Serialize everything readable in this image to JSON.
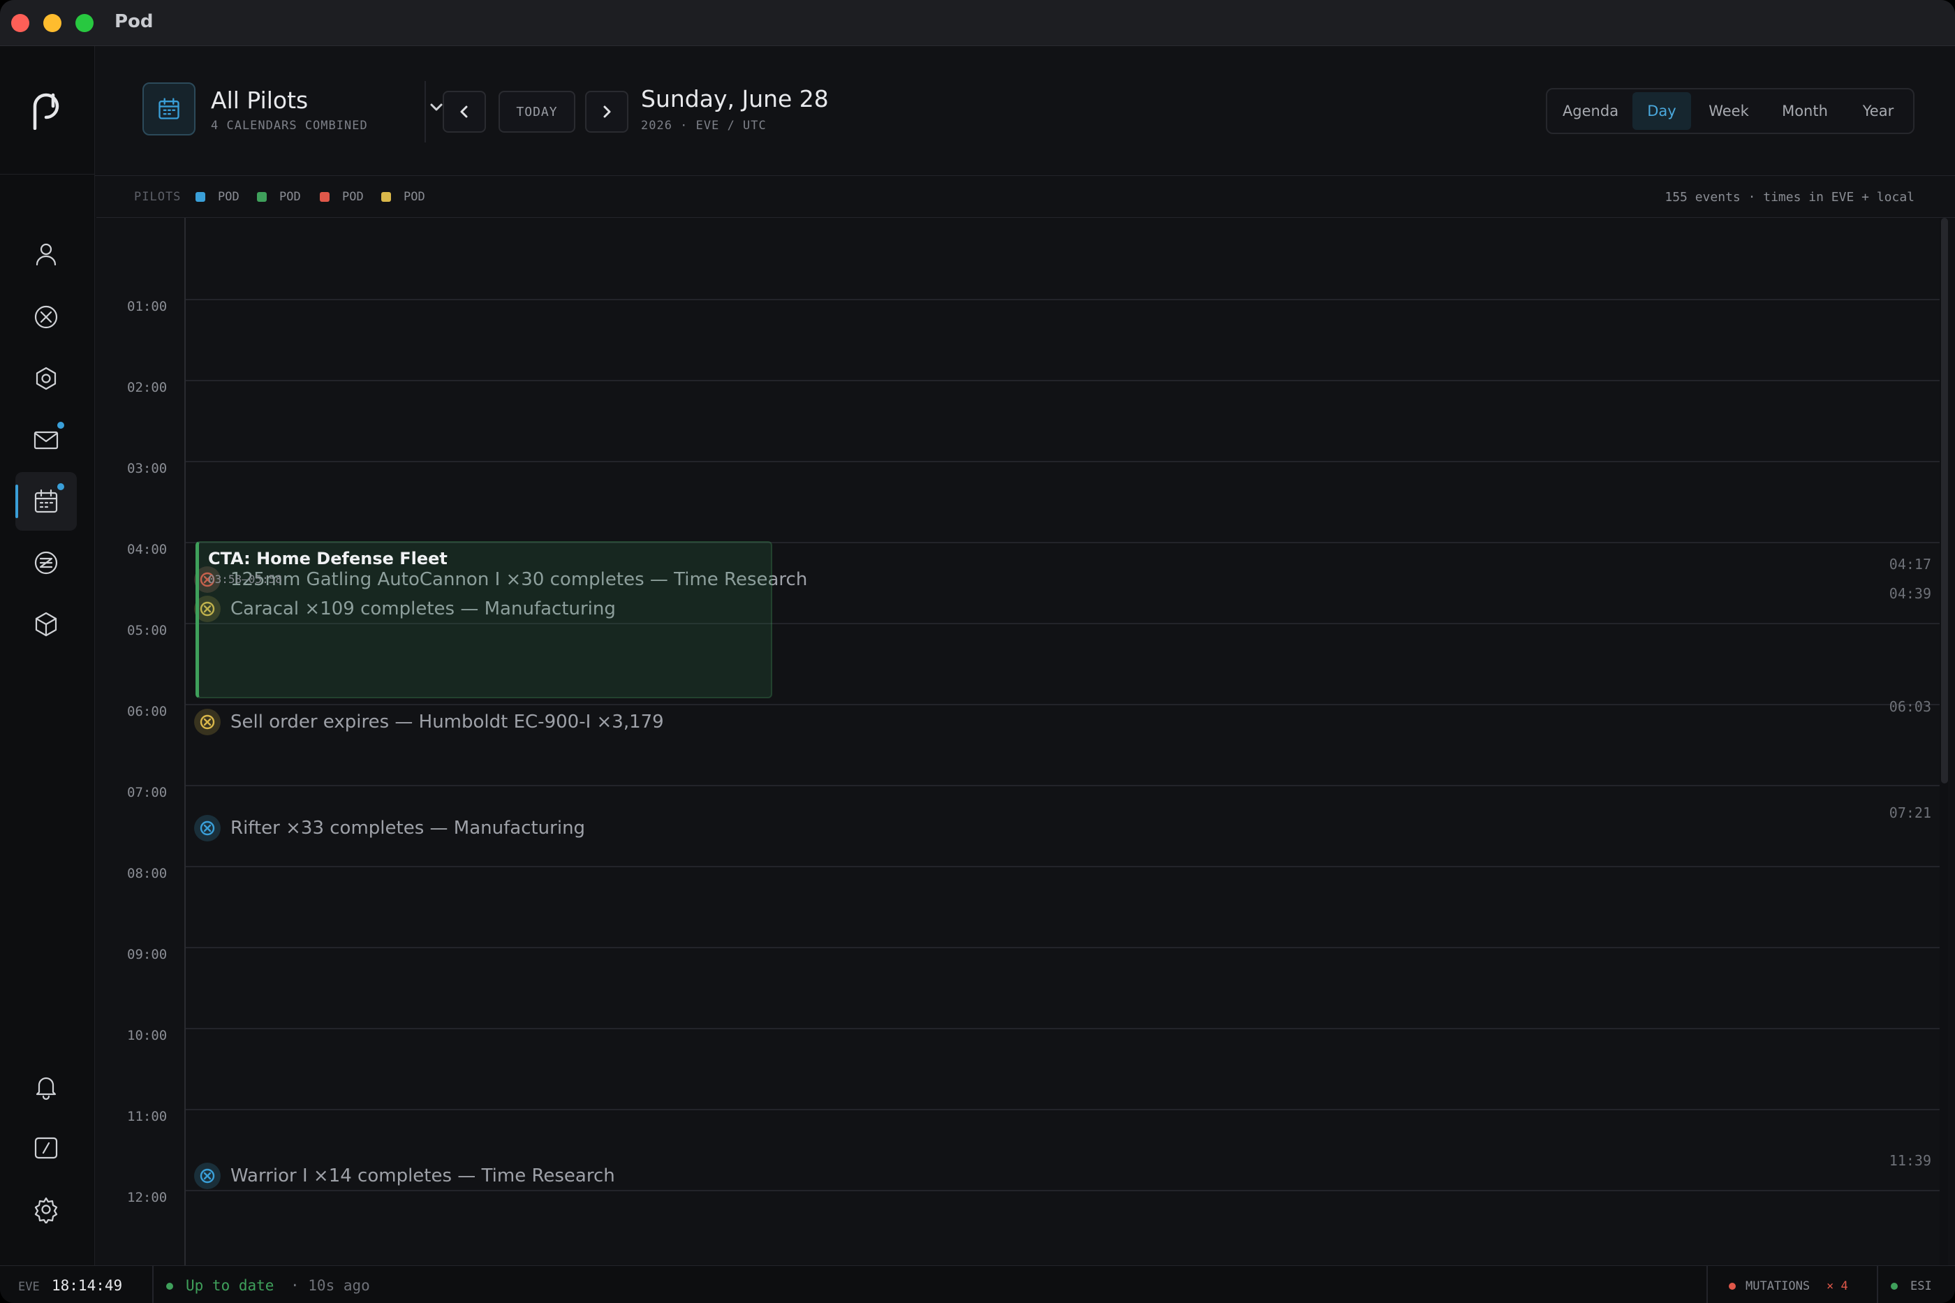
{
  "app": {
    "title": "Pod"
  },
  "colors": {
    "accent": "#3a9fd8",
    "green": "#3fa05b",
    "red": "#e0584a",
    "yellow": "#d9b74a"
  },
  "sidebar": {
    "logo_icon": "pod-logo",
    "items": [
      {
        "name": "pilot-icon"
      },
      {
        "name": "killboard-icon"
      },
      {
        "name": "skills-icon"
      },
      {
        "name": "mail-icon",
        "badge": true
      },
      {
        "name": "calendar-icon",
        "active": true,
        "badge": true
      },
      {
        "name": "isk-icon"
      },
      {
        "name": "assets-icon"
      }
    ],
    "bottom": [
      {
        "name": "bell-icon"
      },
      {
        "name": "terminal-icon"
      },
      {
        "name": "settings-icon"
      }
    ]
  },
  "header": {
    "calendar_title": "All Pilots",
    "calendar_sub": "4 CALENDARS COMBINED",
    "today_label": "TODAY",
    "date_title": "Sunday, June 28",
    "date_sub": "2026 · EVE / UTC",
    "views": [
      "Agenda",
      "Day",
      "Week",
      "Month",
      "Year"
    ],
    "active_view": "Day"
  },
  "legend": {
    "label": "PILOTS",
    "pilots": [
      {
        "name": "POD",
        "color": "#3a9fd8"
      },
      {
        "name": "POD",
        "color": "#3fa05b"
      },
      {
        "name": "POD",
        "color": "#e0584a"
      },
      {
        "name": "POD",
        "color": "#d9b74a"
      }
    ],
    "summary": "155 events · times in EVE + local"
  },
  "hours": [
    "01:00",
    "02:00",
    "03:00",
    "04:00",
    "05:00",
    "06:00",
    "07:00",
    "08:00",
    "09:00",
    "10:00",
    "11:00",
    "12:00"
  ],
  "events": [
    {
      "text": "125mm Gatling AutoCannon I ×30 completes — Time Research",
      "time": "04:17",
      "color": "red"
    },
    {
      "text": "Caracal ×109 completes — Manufacturing",
      "time": "04:39",
      "color": "yellow"
    },
    {
      "text": "Sell order expires — Humboldt EC-900-I ×3,179",
      "time": "06:03",
      "color": "yellow"
    },
    {
      "text": "Rifter ×33 completes — Manufacturing",
      "time": "07:21",
      "color": "blue"
    },
    {
      "text": "Warrior I ×14 completes — Time Research",
      "time": "11:39",
      "color": "blue"
    }
  ],
  "fleet_event": {
    "title": "CTA: Home Defense Fleet",
    "time": "03:58–05:58"
  },
  "statusbar": {
    "eve_label": "EVE",
    "clock": "18:14:49",
    "sync_status": "Up to date",
    "sync_ago": "· 10s ago",
    "mutations_label": "MUTATIONS",
    "mutations_count": "× 4",
    "esi_label": "ESI"
  }
}
